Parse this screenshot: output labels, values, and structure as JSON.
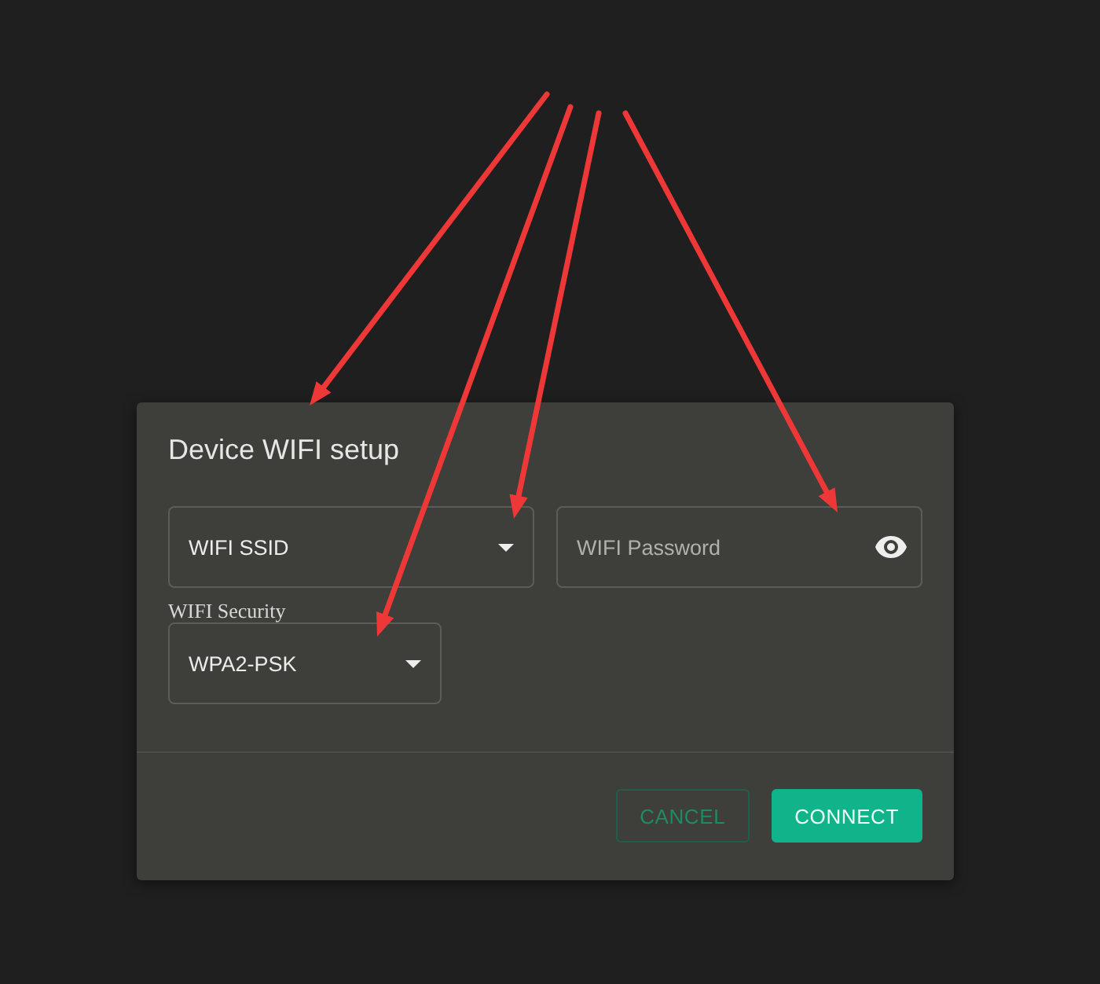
{
  "dialog": {
    "title": "Device WIFI setup",
    "ssid": {
      "value": "WIFI SSID"
    },
    "password": {
      "placeholder": "WIFI Password"
    },
    "security": {
      "label": "WIFI Security",
      "value": "WPA2-PSK"
    },
    "buttons": [
      {
        "label": "CANCEL",
        "kind": "outlined"
      },
      {
        "label": "CONNECT",
        "kind": "filled"
      }
    ]
  }
}
